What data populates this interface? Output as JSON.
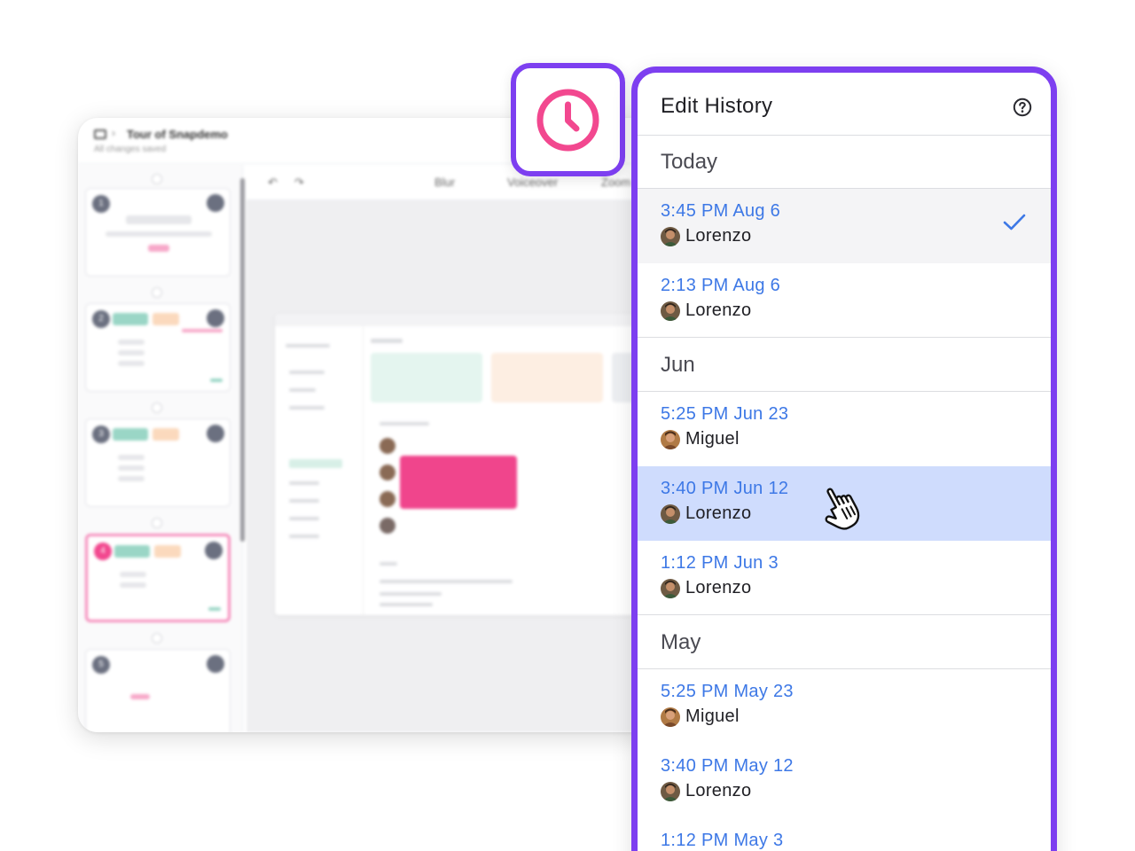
{
  "editor": {
    "breadcrumb_title": "Tour of Snapdemo",
    "saved_status": "All changes saved",
    "toolbar": {
      "blur_label": "Blur",
      "voiceover_label": "Voiceover",
      "zoom_label": "Zoom"
    },
    "steps": [
      {
        "num": "1"
      },
      {
        "num": "2"
      },
      {
        "num": "3"
      },
      {
        "num": "4"
      },
      {
        "num": "5"
      }
    ]
  },
  "history_button": {
    "icon": "clock-icon",
    "accent": "#f2488f",
    "border": "#7d3ff0"
  },
  "panel": {
    "title": "Edit History",
    "help_icon": "help-circle-icon",
    "colors": {
      "time": "#3d78e6",
      "selected_bg": "#f4f4f6",
      "hover_bg": "#cfdcfd",
      "border": "#7d3ff0"
    },
    "groups": [
      {
        "label": "Today",
        "entries": [
          {
            "time": "3:45 PM Aug 6",
            "user": "Lorenzo",
            "selected": true
          },
          {
            "time": "2:13 PM Aug 6",
            "user": "Lorenzo"
          }
        ]
      },
      {
        "label": "Jun",
        "entries": [
          {
            "time": "5:25 PM Jun 23",
            "user": "Miguel"
          },
          {
            "time": "3:40 PM Jun 12",
            "user": "Lorenzo",
            "hovered": true
          },
          {
            "time": "1:12 PM Jun 3",
            "user": "Lorenzo"
          }
        ]
      },
      {
        "label": "May",
        "entries": [
          {
            "time": "5:25 PM May 23",
            "user": "Miguel"
          },
          {
            "time": "3:40 PM May 12",
            "user": "Lorenzo"
          },
          {
            "time": "1:12 PM May 3",
            "user": ""
          }
        ]
      }
    ]
  }
}
